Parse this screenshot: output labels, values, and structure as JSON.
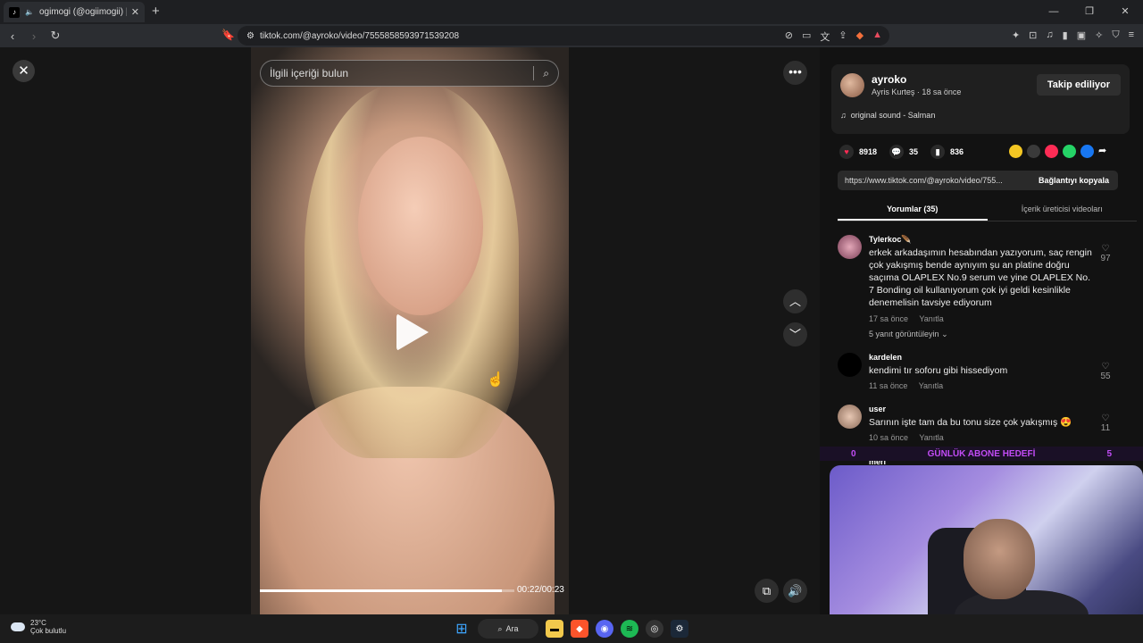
{
  "browser": {
    "tab_title": "ogimogi (@ogiimogii) | TikTo",
    "url": "tiktok.com/@ayroko/video/7555858593971539208"
  },
  "player": {
    "search_placeholder": "İlgili içeriği bulun",
    "time": "00:22/00:23",
    "progress_percent": 95
  },
  "author": {
    "username": "ayroko",
    "subtitle": "Ayris Kurteş · 18 sa önce",
    "follow_label": "Takip ediliyor",
    "sound": "original sound - Salman"
  },
  "stats": {
    "likes": "8918",
    "comments": "35",
    "saves": "836"
  },
  "link": {
    "url": "https://www.tiktok.com/@ayroko/video/755...",
    "copy_label": "Bağlantıyı kopyala"
  },
  "tabs": {
    "comments": "Yorumlar (35)",
    "creator_videos": "İçerik üreticisi videoları"
  },
  "comments": [
    {
      "name": "Tylerkoc🪶",
      "text": "erkek arkadaşımın hesabından yazıyorum, saç rengin çok yakışmış bende aynıyım şu an platine doğru saçıma OLAPLEX No.9 serum ve yine OLAPLEX No. 7 Bonding oil kullanıyorum çok iyi geldi kesinlikle denemelisin tavsiye ediyorum",
      "time": "17 sa önce",
      "reply": "Yanıtla",
      "likes": "97",
      "view_replies": "5 yanıt görüntüleyin"
    },
    {
      "name": "kardelen",
      "text": "kendimi tır soforu gibi hissediyom",
      "time": "11 sa önce",
      "reply": "Yanıtla",
      "likes": "55"
    },
    {
      "name": "user",
      "text": "Sarının işte tam da bu tonu size çok yakışmış 😍",
      "time": "10 sa önce",
      "reply": "Yanıtla",
      "likes": "11"
    },
    {
      "name": "meri"
    }
  ],
  "overlay": {
    "goal_left": "0",
    "goal_title": "GÜNLÜK ABONE HEDEFİ",
    "goal_right": "5"
  },
  "taskbar": {
    "temp": "23°C",
    "weather": "Çok bulutlu",
    "search": "Ara"
  }
}
